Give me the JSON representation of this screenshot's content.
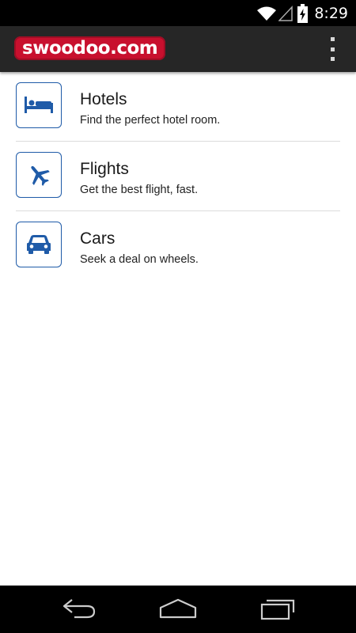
{
  "status_bar": {
    "time": "8:29",
    "icons": [
      "wifi-icon",
      "signal-icon",
      "battery-charging-icon"
    ]
  },
  "action_bar": {
    "logo_text": "swoodoo.com",
    "brand_color": "#c8102e",
    "menu_icon": "overflow-menu-icon"
  },
  "accent_color": "#1f5ba8",
  "items": [
    {
      "title": "Hotels",
      "subtitle": "Find the perfect hotel room.",
      "icon": "bed-icon"
    },
    {
      "title": "Flights",
      "subtitle": "Get the best flight, fast.",
      "icon": "airplane-icon"
    },
    {
      "title": "Cars",
      "subtitle": "Seek a deal on wheels.",
      "icon": "car-icon"
    }
  ],
  "nav_bar": {
    "buttons": [
      "back-icon",
      "home-icon",
      "recents-icon"
    ]
  }
}
